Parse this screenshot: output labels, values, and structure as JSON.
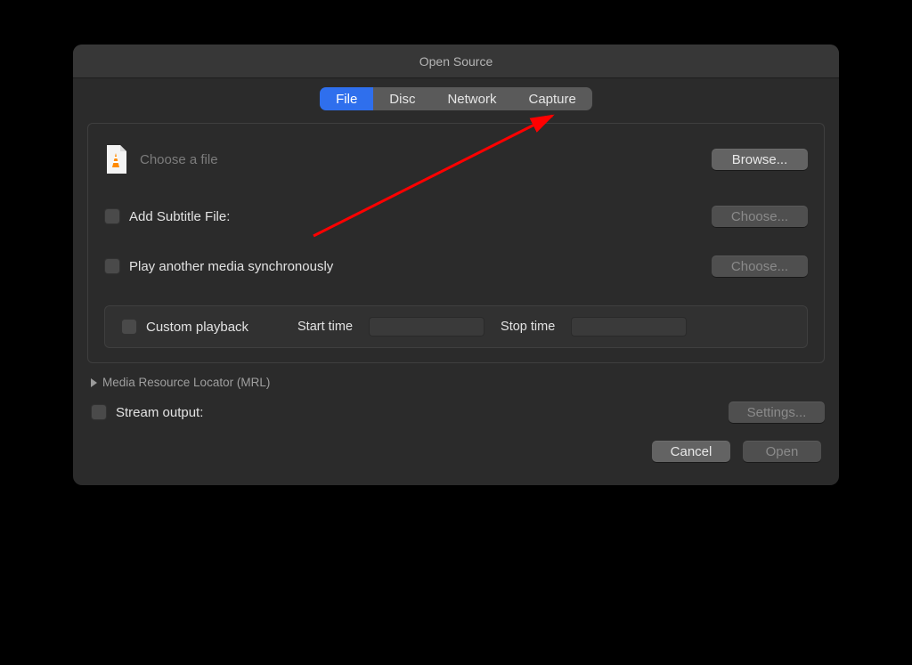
{
  "window": {
    "title": "Open Source"
  },
  "tabs": {
    "items": [
      "File",
      "Disc",
      "Network",
      "Capture"
    ],
    "active": "File"
  },
  "file": {
    "placeholder": "Choose a file",
    "browse": "Browse..."
  },
  "subtitle": {
    "label": "Add Subtitle File:",
    "button": "Choose..."
  },
  "sync": {
    "label": "Play another media synchronously",
    "button": "Choose..."
  },
  "custom": {
    "label": "Custom playback",
    "start": "Start time",
    "stop": "Stop time"
  },
  "mrl": {
    "label": "Media Resource Locator (MRL)"
  },
  "stream": {
    "label": "Stream output:",
    "button": "Settings..."
  },
  "footer": {
    "cancel": "Cancel",
    "open": "Open"
  },
  "annotation": {
    "target": "Capture tab",
    "color": "#ff0000"
  }
}
